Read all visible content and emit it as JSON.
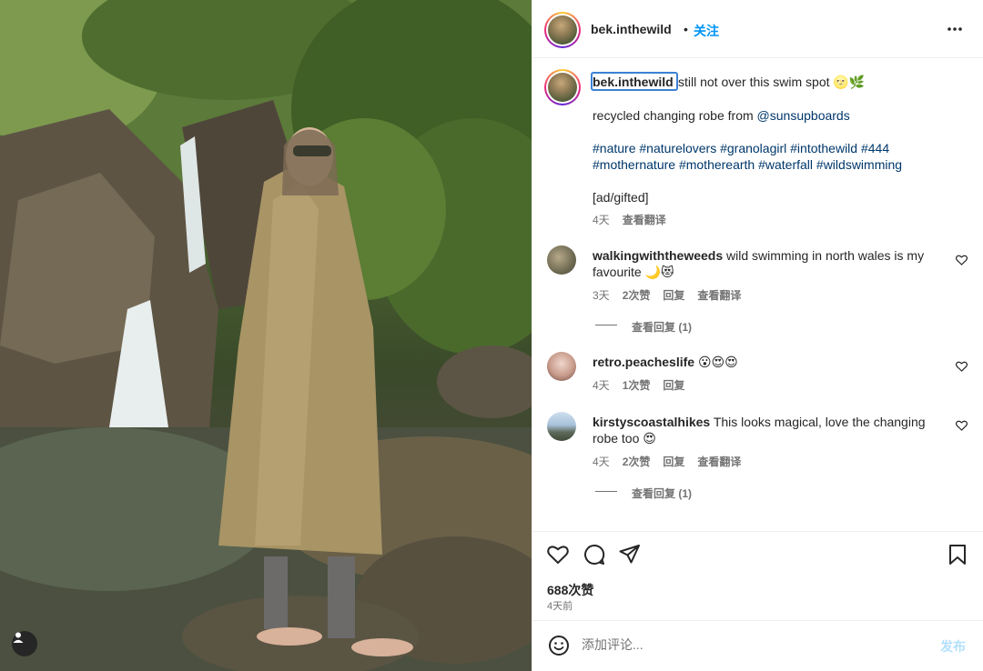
{
  "photo": {
    "alt_icon": "user-tag-icon"
  },
  "header": {
    "username": "bek.inthewild",
    "separator": "•",
    "follow_label": "关注",
    "more_icon": "more-horizontal-icon"
  },
  "caption": {
    "username": "bek.inthewild",
    "line1": "still not over this swim spot 🌝🌿",
    "line2_prefix": "recycled changing robe from ",
    "line2_mention": "@sunsupboards",
    "hashtags_line1": "#nature #naturelovers #granolagirl #intothewild #444",
    "hashtags_line2": "#mothernature #motherearth #waterfall #wildswimming",
    "line4": "[ad/gifted]",
    "time": "4天",
    "translate": "查看翻译"
  },
  "comments": [
    {
      "username": "walkingwiththeweeds",
      "text_line1": "wild swimming in north wales is my",
      "text_line2": "favourite 🌙😻",
      "time": "3天",
      "likes": "2次赞",
      "reply": "回复",
      "translate": "查看翻译",
      "view_replies": "查看回复 (1)"
    },
    {
      "username": "retro.peacheslife",
      "text_line1": "😮😍😍",
      "time": "4天",
      "likes": "1次赞",
      "reply": "回复"
    },
    {
      "username": "kirstyscoastalhikes",
      "text_line1": "This looks magical, love the changing",
      "text_line2": "robe too 😍",
      "time": "4天",
      "likes": "2次赞",
      "reply": "回复",
      "translate": "查看翻译",
      "view_replies": "查看回复 (1)"
    }
  ],
  "actions": {
    "like_icon": "heart-icon",
    "comment_icon": "comment-icon",
    "share_icon": "share-icon",
    "save_icon": "bookmark-icon",
    "likes": "688次赞",
    "posted": "4天前"
  },
  "add_comment": {
    "placeholder": "添加评论...",
    "post_label": "发布",
    "emoji_icon": "emoji-icon"
  },
  "colors": {
    "accent": "#0095f6",
    "hashtag": "#00376b",
    "meta": "#737373"
  }
}
